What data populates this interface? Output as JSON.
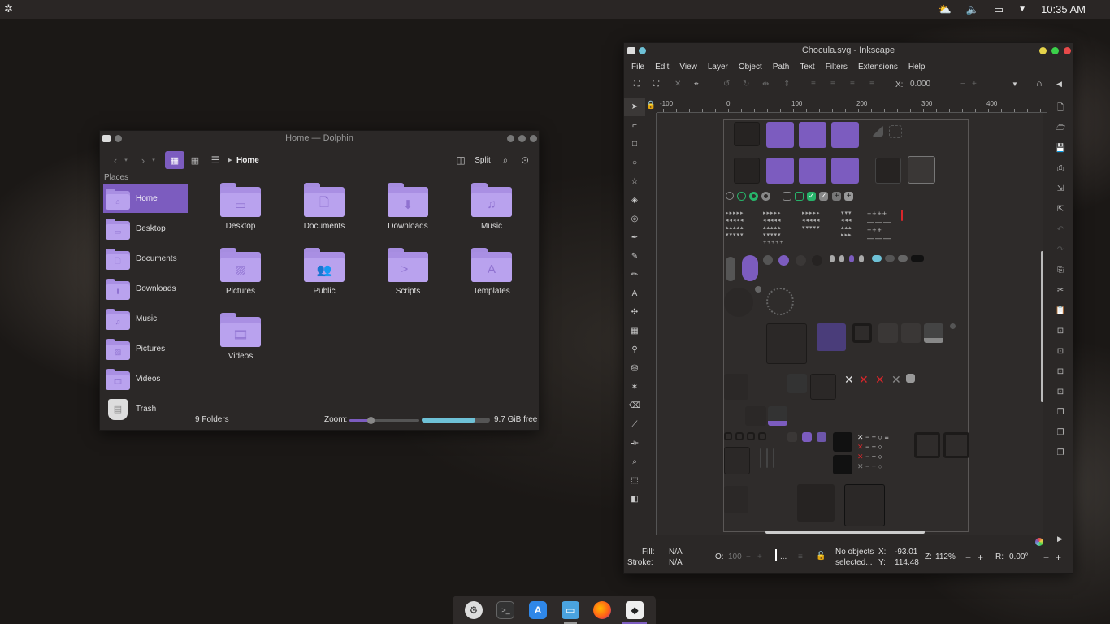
{
  "topbar": {
    "clock": "10:35 AM",
    "icons": [
      "launcher-icon",
      "weather-icon",
      "volume-icon",
      "display-icon",
      "chevron-down-icon"
    ]
  },
  "dolphin": {
    "title": "Home — Dolphin",
    "breadcrumb": "Home",
    "split_label": "Split",
    "places_label": "Places",
    "places": [
      {
        "label": "Home",
        "icon": "home-icon",
        "active": true
      },
      {
        "label": "Desktop",
        "icon": "desktop-icon"
      },
      {
        "label": "Documents",
        "icon": "document-icon"
      },
      {
        "label": "Downloads",
        "icon": "download-icon"
      },
      {
        "label": "Music",
        "icon": "music-icon"
      },
      {
        "label": "Pictures",
        "icon": "picture-icon"
      },
      {
        "label": "Videos",
        "icon": "video-icon"
      },
      {
        "label": "Trash",
        "icon": "trash-icon"
      }
    ],
    "folders": [
      {
        "label": "Desktop",
        "glyph": "▭"
      },
      {
        "label": "Documents",
        "glyph": "🗋"
      },
      {
        "label": "Downloads",
        "glyph": "⬇"
      },
      {
        "label": "Music",
        "glyph": "♫"
      },
      {
        "label": "Pictures",
        "glyph": "▨"
      },
      {
        "label": "Public",
        "glyph": "👥"
      },
      {
        "label": "Scripts",
        "glyph": ">_"
      },
      {
        "label": "Templates",
        "glyph": "A"
      },
      {
        "label": "Videos",
        "glyph": "🎞"
      }
    ],
    "status": {
      "count": "9 Folders",
      "zoom_label": "Zoom:",
      "zoom_value": 0.3,
      "space_used": 0.78,
      "free": "9.7 GiB free"
    }
  },
  "inkscape": {
    "title": "Chocula.svg - Inkscape",
    "menu": [
      "File",
      "Edit",
      "View",
      "Layer",
      "Object",
      "Path",
      "Text",
      "Filters",
      "Extensions",
      "Help"
    ],
    "x_label": "X:",
    "x_value": "0.000",
    "ruler_ticks": [
      "-100",
      "0",
      "100",
      "200",
      "300",
      "400"
    ],
    "bottom": {
      "fill_label": "Fill:",
      "fill_value": "N/A",
      "stroke_label": "Stroke:",
      "stroke_value": "N/A",
      "opacity_label": "O:",
      "opacity_value": "100",
      "message_line1": "No objects",
      "message_line2": "selected...",
      "x_label": "X:",
      "x_value": "-93.01",
      "y_label": "Y:",
      "y_value": "114.48",
      "zoom_label": "Z:",
      "zoom_value": "112%",
      "rotate_label": "R:",
      "rotate_value": "0.00°"
    },
    "colors": {
      "accent": "#7c5cbf",
      "green": "#27b36a",
      "red": "#d9262b",
      "blue": "#6ec1d6"
    }
  },
  "dock": {
    "apps": [
      "settings-icon",
      "terminal-icon",
      "app-store-icon",
      "files-icon",
      "firefox-icon",
      "inkscape-icon"
    ]
  }
}
